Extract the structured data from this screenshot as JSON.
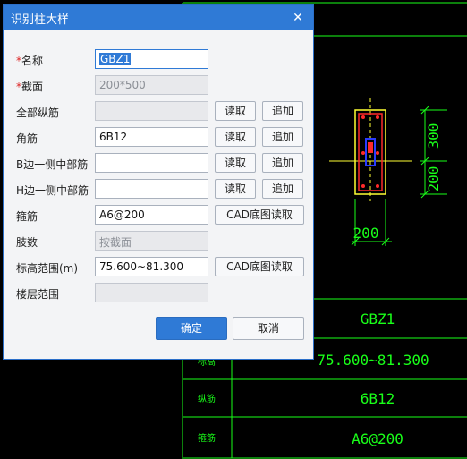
{
  "dialog": {
    "title": "识别柱大样",
    "close_icon": "close-icon",
    "fields": [
      {
        "key": "name",
        "label": "名称",
        "required": true,
        "value": "GBZ1",
        "state": "active"
      },
      {
        "key": "section",
        "label": "截面",
        "required": true,
        "value": "200*500",
        "state": "disabled"
      },
      {
        "key": "all_long_bar",
        "label": "全部纵筋",
        "value": "",
        "state": "disabled"
      },
      {
        "key": "corner_bar",
        "label": "角筋",
        "value": "6B12",
        "state": "normal"
      },
      {
        "key": "b_side_mid_bar",
        "label": "B边一侧中部筋",
        "value": "",
        "state": "normal"
      },
      {
        "key": "h_side_mid_bar",
        "label": "H边一侧中部筋",
        "value": "",
        "state": "normal"
      },
      {
        "key": "stirrup",
        "label": "箍筋",
        "value": "A6@200",
        "state": "normal"
      },
      {
        "key": "limbs",
        "label": "肢数",
        "value": "按截面",
        "state": "disabled"
      },
      {
        "key": "elevation_range",
        "label": "标高范围(m)",
        "value": "75.600~81.300",
        "state": "normal"
      },
      {
        "key": "floor_range",
        "label": "楼层范围",
        "value": "",
        "state": "disabled"
      }
    ],
    "read_label": "读取",
    "append_label": "追加",
    "cad_read_label": "CAD底图读取",
    "ok_label": "确定",
    "cancel_label": "取消"
  },
  "cad": {
    "dim_300": "300",
    "dim_200_vertical": "200",
    "dim_200_horizontal": "200",
    "table_values": [
      "GBZ1",
      "75.600~81.300",
      "6B12",
      "A6@200"
    ],
    "table_row_labels": [
      "标高",
      "纵筋",
      "箍筋"
    ],
    "colors": {
      "line": "#19ff19",
      "yellow": "#ffff33",
      "red": "#ff2a2a",
      "blue": "#2a3cff"
    }
  }
}
